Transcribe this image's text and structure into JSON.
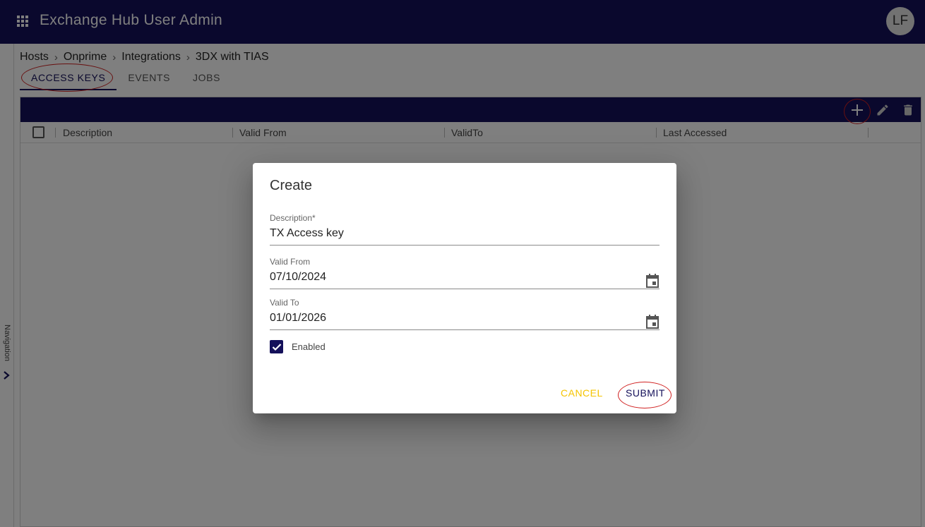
{
  "app": {
    "title": "Exchange Hub User Admin",
    "user_initials": "LF",
    "brand_color": "#14105a"
  },
  "nav": {
    "label": "Navigation"
  },
  "breadcrumb": [
    "Hosts",
    "Onprime",
    "Integrations",
    "3DX with TIAS"
  ],
  "tabs": [
    {
      "label": "ACCESS KEYS",
      "active": true
    },
    {
      "label": "EVENTS",
      "active": false
    },
    {
      "label": "JOBS",
      "active": false
    }
  ],
  "grid": {
    "toolbar_icons": [
      "add-icon",
      "edit-icon",
      "delete-icon"
    ],
    "columns": [
      "Description",
      "Valid From",
      "ValidTo",
      "Last Accessed"
    ],
    "rows": []
  },
  "dialog": {
    "title": "Create",
    "description": {
      "label": "Description",
      "required_marker": "*",
      "value": "TX Access key"
    },
    "valid_from": {
      "label": "Valid From",
      "value": "07/10/2024"
    },
    "valid_to": {
      "label": "Valid To",
      "value": "01/01/2026"
    },
    "enabled": {
      "label": "Enabled",
      "checked": true
    },
    "cancel_label": "CANCEL",
    "submit_label": "SUBMIT",
    "cancel_color": "#f5c400"
  }
}
